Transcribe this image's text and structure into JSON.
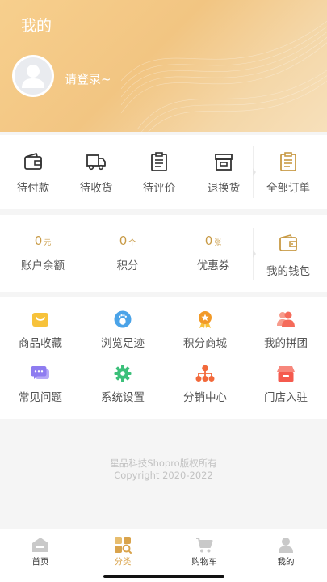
{
  "header": {
    "title": "我的",
    "login_text": "请登录~"
  },
  "orders": {
    "items": [
      {
        "label": "待付款",
        "icon": "wallet-icon"
      },
      {
        "label": "待收货",
        "icon": "truck-icon"
      },
      {
        "label": "待评价",
        "icon": "clipboard-icon"
      },
      {
        "label": "退换货",
        "icon": "return-box-icon"
      }
    ],
    "all": {
      "label": "全部订单",
      "icon": "order-list-icon"
    }
  },
  "wallet": {
    "items": [
      {
        "value": "0",
        "unit": "元",
        "label": "账户余额"
      },
      {
        "value": "0",
        "unit": "个",
        "label": "积分"
      },
      {
        "value": "0",
        "unit": "张",
        "label": "优惠券"
      }
    ],
    "mine": {
      "label": "我的钱包",
      "icon": "wallet-icon"
    }
  },
  "tools": {
    "items": [
      {
        "label": "商品收藏",
        "icon": "favorites-icon",
        "color": "#f7c23a"
      },
      {
        "label": "浏览足迹",
        "icon": "footprint-icon",
        "color": "#4aa3e8"
      },
      {
        "label": "积分商城",
        "icon": "medal-icon",
        "color": "#f29a28"
      },
      {
        "label": "我的拼团",
        "icon": "group-icon",
        "color": "#f56b5a"
      },
      {
        "label": "常见问题",
        "icon": "chat-icon",
        "color": "#8e7cf0"
      },
      {
        "label": "系统设置",
        "icon": "settings-icon",
        "color": "#3cc07a"
      },
      {
        "label": "分销中心",
        "icon": "distribution-icon",
        "color": "#f2693b"
      },
      {
        "label": "门店入驻",
        "icon": "store-icon",
        "color": "#f55a4e"
      }
    ]
  },
  "footer": {
    "line1": "星品科技Shopro版权所有",
    "line2": "Copyright 2020-2022"
  },
  "tabbar": {
    "tabs": [
      {
        "label": "首页",
        "icon": "home-icon"
      },
      {
        "label": "分类",
        "icon": "category-icon",
        "active": true
      },
      {
        "label": "购物车",
        "icon": "cart-icon"
      },
      {
        "label": "我的",
        "icon": "profile-icon"
      }
    ]
  },
  "colors": {
    "accent": "#d9a34b",
    "header_bg": "#f2c582"
  }
}
